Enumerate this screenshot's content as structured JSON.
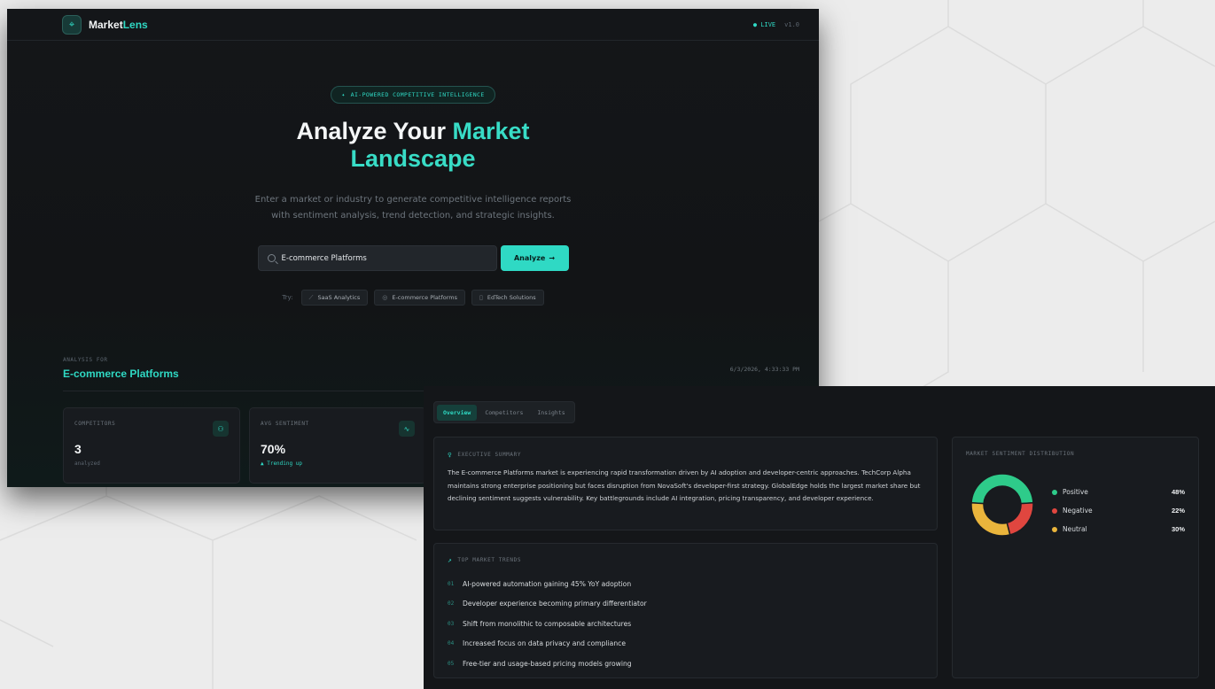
{
  "colors": {
    "accent": "#2fd9c4",
    "positive": "#2ecb8a",
    "negative": "#e0463f",
    "neutral": "#eab53c"
  },
  "header": {
    "logo_icon": "crosshair-icon",
    "brand_first": "Market",
    "brand_second": "Lens",
    "live_label": "● LIVE",
    "version": "v1.0"
  },
  "hero": {
    "pill_icon": "sparkle-icon",
    "pill_text": "AI-POWERED COMPETITIVE INTELLIGENCE",
    "headline_white": "Analyze Your ",
    "headline_accent_1": "Market",
    "headline_accent_2": "Landscape",
    "subtext": "Enter a market or industry to generate competitive intelligence reports with sentiment analysis, trend detection, and strategic insights."
  },
  "search": {
    "value": "E-commerce Platforms",
    "button_label": "Analyze",
    "button_arrow": "→"
  },
  "suggestions": {
    "label": "Try:",
    "items": [
      {
        "icon_glyph": "⟋",
        "icon": "trend-icon",
        "label": "SaaS Analytics"
      },
      {
        "icon_glyph": "◎",
        "icon": "globe-icon",
        "label": "E-commerce Platforms"
      },
      {
        "icon_glyph": "▯",
        "icon": "book-icon",
        "label": "EdTech Solutions"
      }
    ]
  },
  "analysis": {
    "label": "ANALYSIS FOR",
    "market": "E-commerce Platforms",
    "timestamp": "6/3/2026, 4:33:33 PM"
  },
  "stats": [
    {
      "label": "COMPETITORS",
      "value": "3",
      "sub": "analyzed",
      "icon": "users-icon",
      "icon_glyph": "⚇"
    },
    {
      "label": "AVG SENTIMENT",
      "value": "70%",
      "sub": "▲ Trending up",
      "icon": "activity-icon",
      "icon_glyph": "∿"
    }
  ],
  "tabs": [
    {
      "label": "Overview",
      "active": true
    },
    {
      "label": "Competitors",
      "active": false
    },
    {
      "label": "Insights",
      "active": false
    }
  ],
  "summary": {
    "title": "EXECUTIVE SUMMARY",
    "icon": "lightbulb-icon",
    "text": "The E-commerce Platforms market is experiencing rapid transformation driven by AI adoption and developer-centric approaches. TechCorp Alpha maintains strong enterprise positioning but faces disruption from NovaSoft's developer-first strategy. GlobalEdge holds the largest market share but declining sentiment suggests vulnerability. Key battlegrounds include AI integration, pricing transparency, and developer experience."
  },
  "trends": {
    "title": "TOP MARKET TRENDS",
    "icon": "trending-up-icon",
    "items": [
      {
        "num": "01",
        "text": "AI-powered automation gaining 45% YoY adoption"
      },
      {
        "num": "02",
        "text": "Developer experience becoming primary differentiator"
      },
      {
        "num": "03",
        "text": "Shift from monolithic to composable architectures"
      },
      {
        "num": "04",
        "text": "Increased focus on data privacy and compliance"
      },
      {
        "num": "05",
        "text": "Free-tier and usage-based pricing models growing"
      }
    ]
  },
  "chart_data": {
    "type": "pie",
    "title": "MARKET SENTIMENT DISTRIBUTION",
    "categories": [
      "Positive",
      "Negative",
      "Neutral"
    ],
    "values": [
      48,
      22,
      30
    ],
    "labels": [
      "48%",
      "22%",
      "30%"
    ],
    "colors": [
      "#2ecb8a",
      "#e0463f",
      "#eab53c"
    ],
    "donut": true
  }
}
